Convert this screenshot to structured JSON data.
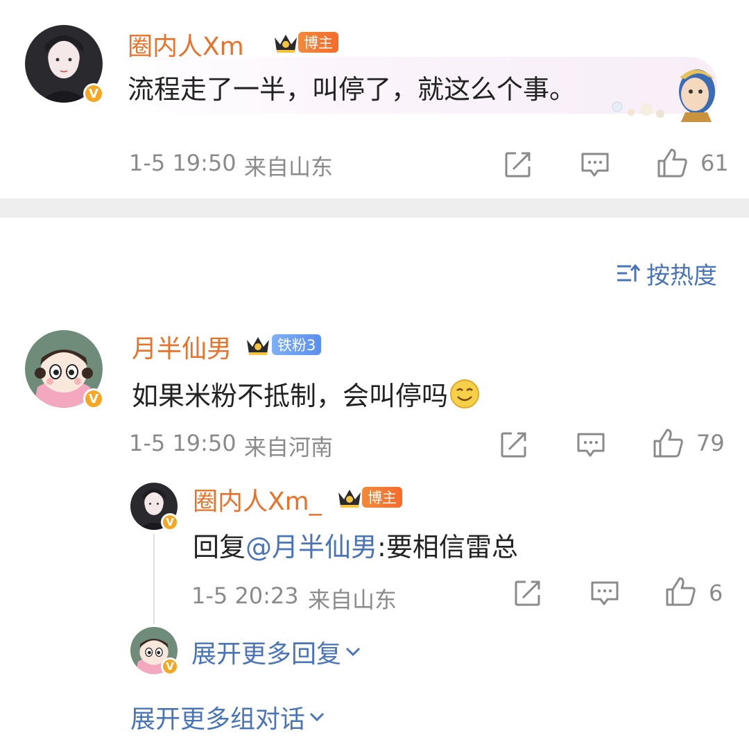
{
  "top_comment": {
    "username": "圈内人Xm_",
    "badge": "博主",
    "text": "流程走了一半，叫停了，就这么个事。",
    "time": "1-5 19:50",
    "location": "来自山东",
    "likes": "61"
  },
  "sort": {
    "label": "按热度",
    "icon": "sort-icon"
  },
  "comment": {
    "username": "月半仙男",
    "badge": "铁粉3",
    "text": "如果米粉不抵制，会叫停吗",
    "time": "1-5 19:50",
    "location": "来自河南",
    "likes": "79"
  },
  "reply": {
    "username": "圈内人Xm_",
    "badge": "博主",
    "prefix": "回复",
    "mention": "@月半仙男",
    "text": ":要相信雷总",
    "time": "1-5 20:23",
    "location": "来自山东",
    "likes": "6"
  },
  "more_replies": "展开更多回复",
  "more_groups": "展开更多组对话",
  "colors": {
    "username": "#e8722a",
    "link": "#4a74b8",
    "meta": "#8a8a8a",
    "divider": "#eeeeee",
    "verified": "#f5a623"
  }
}
